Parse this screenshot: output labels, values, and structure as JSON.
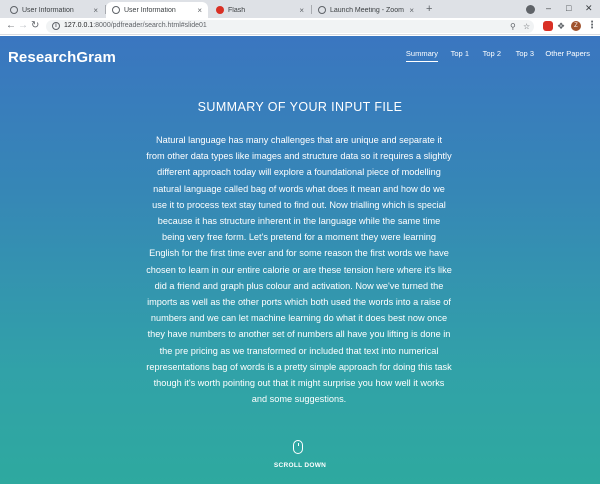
{
  "browser": {
    "tabs": [
      {
        "title": "User Information",
        "active": false,
        "favicon_color": "#5f6368"
      },
      {
        "title": "User Information",
        "active": true,
        "favicon_color": "#5f6368"
      },
      {
        "title": "Flash",
        "active": false,
        "favicon_color": "#d93025"
      },
      {
        "title": "Launch Meeting - Zoom",
        "active": false,
        "favicon_color": "#5f6368"
      }
    ],
    "tab_close_glyph": "×",
    "new_tab_glyph": "+",
    "url_host": "127.0.0.1",
    "url_path": ":8000/pdfreader/search.html#slide01",
    "profile_initial": "Z"
  },
  "site": {
    "brand": "ResearchGram",
    "nav": [
      "Summary",
      "Top 1",
      "Top 2",
      "Top 3",
      "Other Papers"
    ],
    "active_nav": "Summary",
    "heading": "SUMMARY OF YOUR INPUT FILE",
    "summary": "Natural language has many challenges that are unique and separate it from other data types like images and structure data so it requires a slightly different approach today will explore a foundational piece of modelling natural language called bag of words what does it mean and how do we use it to process text stay tuned to find out. Now trialling which is special because it has structure inherent in the language while the same time being very free form. Let's pretend for a moment they were learning English for the first time ever and for some reason the first words we have chosen to learn in our entire calorie or are these tension here where it's like did a friend and graph plus colour and activation. Now we've turned the imports as well as the other ports which both used the words into a raise of numbers and we can let machine learning do what it does best now once they have numbers to another set of numbers all have you lifting is done in the pre pricing as we transformed or included that text into numerical representations bag of words is a pretty simple approach for doing this task though it's worth pointing out that it might surprise you how well it works and some suggestions.",
    "scroll_label": "SCROLL DOWN"
  },
  "colors": {
    "gradient_top": "#3a76c0",
    "gradient_bottom": "#2ea99f",
    "text": "#ffffff"
  }
}
